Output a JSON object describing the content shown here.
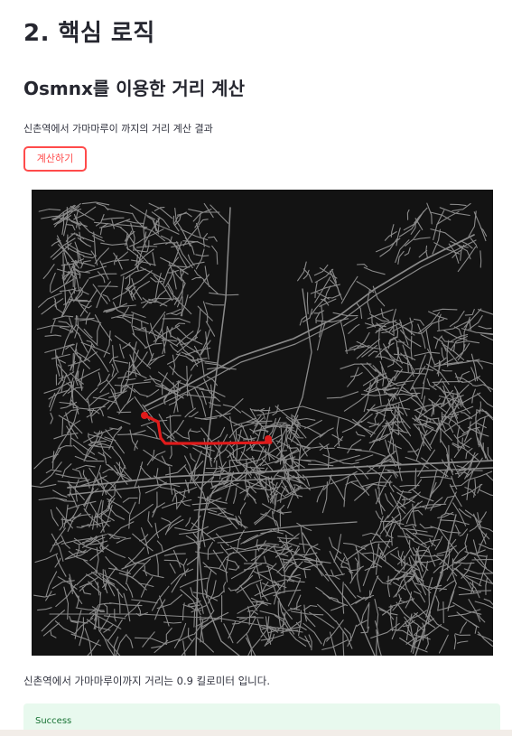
{
  "section_title": "2. 핵심 로직",
  "subtitle": "Osmnx를 이용한 거리 계산",
  "description": "신촌역에서 가마마루이 까지의 거리 계산 결과",
  "calc_button_label": "계산하기",
  "result_text": "신촌역에서 가마마루이까지 거리는 0.9 킬로미터 입니다.",
  "alert": {
    "text": "Success",
    "status": "success"
  },
  "map": {
    "background_color": "#131313",
    "road_color": "#8a8a8a",
    "route_color": "#e01b1b"
  }
}
